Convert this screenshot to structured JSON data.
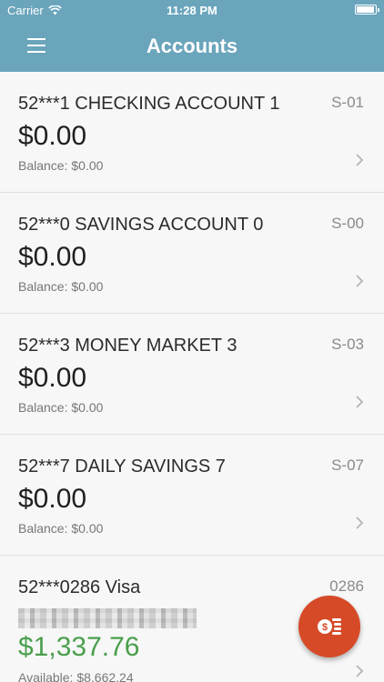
{
  "status_bar": {
    "carrier": "Carrier",
    "time": "11:28 PM",
    "battery_level": 0.95
  },
  "header": {
    "title": "Accounts",
    "background_color": "#6aa5bc"
  },
  "accounts": [
    {
      "name": "52***1 CHECKING ACCOUNT 1",
      "code": "S-01",
      "amount": "$0.00",
      "sub": "Balance: $0.00"
    },
    {
      "name": "52***0 SAVINGS ACCOUNT 0",
      "code": "S-00",
      "amount": "$0.00",
      "sub": "Balance: $0.00"
    },
    {
      "name": "52***3 MONEY MARKET 3",
      "code": "S-03",
      "amount": "$0.00",
      "sub": "Balance: $0.00"
    },
    {
      "name": "52***7 DAILY SAVINGS 7",
      "code": "S-07",
      "amount": "$0.00",
      "sub": "Balance: $0.00"
    }
  ],
  "card": {
    "name": "52***0286 Visa",
    "code": "0286",
    "amount": "$1,337.76",
    "sub": "Available: $8,662.24",
    "amount_color": "#4a9f4c"
  },
  "fab": {
    "icon": "transfer-money-icon",
    "color": "#d64a27"
  },
  "icons": {
    "menu": "hamburger-menu-icon",
    "row_arrow": "chevron-right-icon",
    "wifi": "wifi-icon",
    "battery": "battery-icon"
  }
}
